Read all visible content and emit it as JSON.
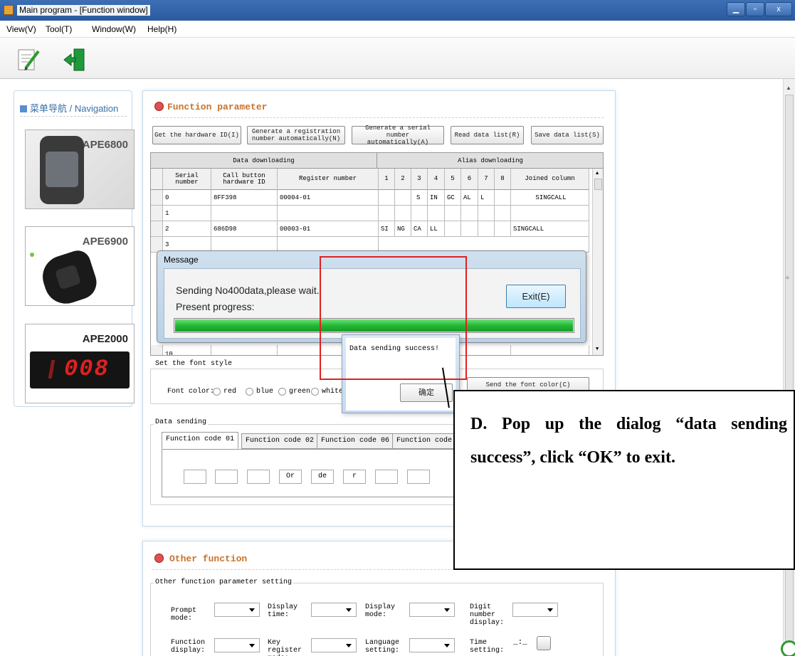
{
  "window": {
    "title": "Main program - [Function window]"
  },
  "menu": [
    "View(V)",
    "Tool(T)",
    "Window(W)",
    "Help(H)"
  ],
  "toolbar": {
    "icons": [
      "edit-icon",
      "exit-door-icon"
    ]
  },
  "nav": {
    "header": "菜单导航 / Navigation",
    "devices": [
      {
        "label": "APE6800",
        "image": "smartwatch"
      },
      {
        "label": "APE6900",
        "image": "wristband"
      },
      {
        "label": "APE2000",
        "image": "led-display",
        "display": "008"
      }
    ]
  },
  "function_panel": {
    "title": "Function parameter",
    "buttons": [
      "Get the hardware ID(I)",
      "Generate a registration number automatically(N)",
      "Generate a serial number automatically(A)",
      "Read data list(R)",
      "Save data list(S)"
    ],
    "grid": {
      "group_headers": [
        "Data downloading",
        "Alias downloading"
      ],
      "columns": [
        "Serial number",
        "Call button hardware ID",
        "Register number",
        "1",
        "2",
        "3",
        "4",
        "5",
        "6",
        "7",
        "8",
        "Joined column"
      ],
      "rows": [
        [
          "0",
          "8FF398",
          "00004-01",
          "",
          "",
          "S",
          "IN",
          "GC",
          "AL",
          "L",
          "",
          "SINGCALL"
        ],
        [
          "1",
          "",
          "",
          "",
          "",
          "",
          "",
          "",
          "",
          "",
          "",
          ""
        ],
        [
          "2",
          "686D98",
          "00003-01",
          "SI",
          "NG",
          "CA",
          "LL",
          "",
          "",
          "",
          "",
          "SINGCALL"
        ],
        [
          "3",
          "",
          "",
          "",
          "",
          "",
          "",
          "",
          "",
          "",
          "",
          ""
        ],
        [
          "10",
          "",
          "",
          "",
          "",
          "",
          "",
          "",
          "",
          "",
          "",
          ""
        ]
      ]
    },
    "font_style": {
      "group_label": "Set the font style",
      "font_color_label": "Font color:",
      "colors": [
        "red",
        "blue",
        "green",
        "white"
      ],
      "send_button": "Send the font color(C)"
    },
    "data_sending": {
      "group_label": "Data sending",
      "tabs": [
        "Function code 01",
        "Function code 02",
        "Function code 06",
        "Function code"
      ],
      "inputs": [
        "",
        "",
        "",
        "Or",
        "de",
        "r",
        "",
        ""
      ]
    }
  },
  "message_dialog": {
    "title": "Message",
    "line1": "Sending No400data,please wait.",
    "line2": "Present progress:",
    "exit_button": "Exit(E)",
    "progress": 1.0
  },
  "success_dialog": {
    "text": "Data sending success!",
    "ok_button": "确定"
  },
  "callout": {
    "text": "D. Pop up the dialog “data sending success”, click “OK” to exit."
  },
  "other_panel": {
    "title": "Other function",
    "group_label": "Other function parameter setting",
    "row1": [
      "Prompt mode:",
      "Display time:",
      "Display mode:",
      "Digit number display:"
    ],
    "row2": [
      "Function display:",
      "Key register mode:",
      "Language setting:",
      "Time setting:"
    ],
    "time_value": "_:_"
  },
  "colors": {
    "titlebar": "#2a5aa0",
    "accent": "#c8732a",
    "progress": "#22b833",
    "highlight": "#e02020"
  }
}
